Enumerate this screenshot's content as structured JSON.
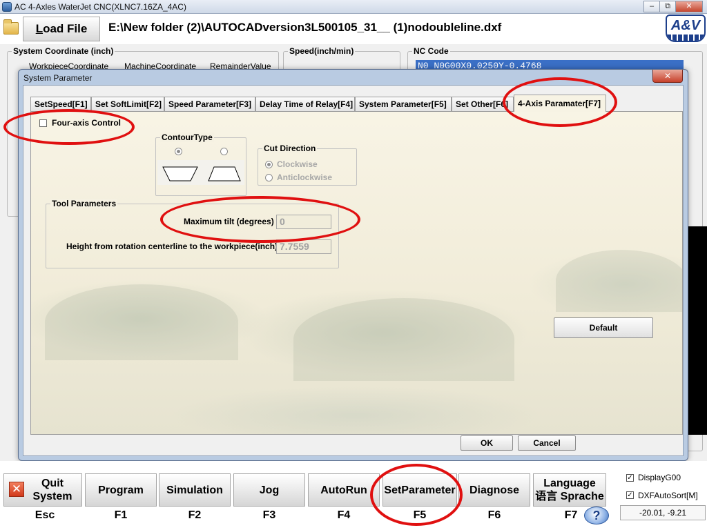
{
  "window": {
    "title": "AC 4-Axles WaterJet CNC(XLNC7.16ZA_4AC)",
    "min_symbol": "–",
    "max_symbol": "⧉",
    "close_symbol": "✕"
  },
  "toolbar": {
    "load_file_label": "Load File",
    "file_path": "E:\\New folder (2)\\AUTOCADversion3L500105_31__ (1)nodoubleline.dxf",
    "logo_text": "A&V"
  },
  "background": {
    "system_coordinate_label": "System Coordinate (inch)",
    "workpiece_coordinate_label": "WorkpieceCoordinate",
    "machine_coordinate_label": "MachineCoordinate",
    "remainder_value_label": "RemainderValue",
    "speed_label": "Speed(inch/min)",
    "nc_code_label": "NC Code",
    "nc_code_line": "N0 N0G00X0.0250Y-0.4768"
  },
  "dialog": {
    "title": "System Parameter",
    "close_symbol": "✕",
    "tabs": [
      {
        "label": "SetSpeed[F1]"
      },
      {
        "label": "Set SoftLimit[F2]"
      },
      {
        "label": "Speed Parameter[F3]"
      },
      {
        "label": "Delay Time of Relay[F4]"
      },
      {
        "label": "System Parameter[F5]"
      },
      {
        "label": "Set Other[F6]"
      },
      {
        "label": "4-Axis Paramater[F7]"
      }
    ],
    "four_axis_control_label": "Four-axis Control",
    "contour_type_label": "ContourType",
    "cut_direction_label": "Cut Direction",
    "clockwise_label": "Clockwise",
    "anticlockwise_label": "Anticlockwise",
    "tool_parameters_label": "Tool Parameters",
    "max_tilt_label": "Maximum tilt (degrees)",
    "max_tilt_value": "0",
    "height_label": "Height from rotation centerline to the workpiece(inch)",
    "height_value": "7.7559",
    "default_label": "Default",
    "ok_label": "OK",
    "cancel_label": "Cancel"
  },
  "function_bar": {
    "keys": [
      {
        "line1": "Quit",
        "line2": "System",
        "code": "Esc"
      },
      {
        "line1": "Program",
        "line2": "",
        "code": "F1"
      },
      {
        "line1": "Simulation",
        "line2": "",
        "code": "F2"
      },
      {
        "line1": "Jog",
        "line2": "",
        "code": "F3"
      },
      {
        "line1": "AutoRun",
        "line2": "",
        "code": "F4"
      },
      {
        "line1": "SetParameter",
        "line2": "",
        "code": "F5"
      },
      {
        "line1": "Diagnose",
        "line2": "",
        "code": "F6"
      },
      {
        "line1": "Language",
        "line2": "语言 Sprache",
        "code": "F7"
      }
    ],
    "display_g00_label": "DisplayG00",
    "dxf_autosort_label": "DXFAutoSort[M]",
    "coordinates": "-20.01,  -9.21",
    "help_symbol": "?",
    "quit_icon_symbol": "✕",
    "check_mark": "✓"
  },
  "colors": {
    "highlight_oval": "#e01010",
    "nc_selection": "#3a6fc6",
    "dialog_frame": "#b9cbe2",
    "tab_page_background": "#f5f1e2"
  }
}
